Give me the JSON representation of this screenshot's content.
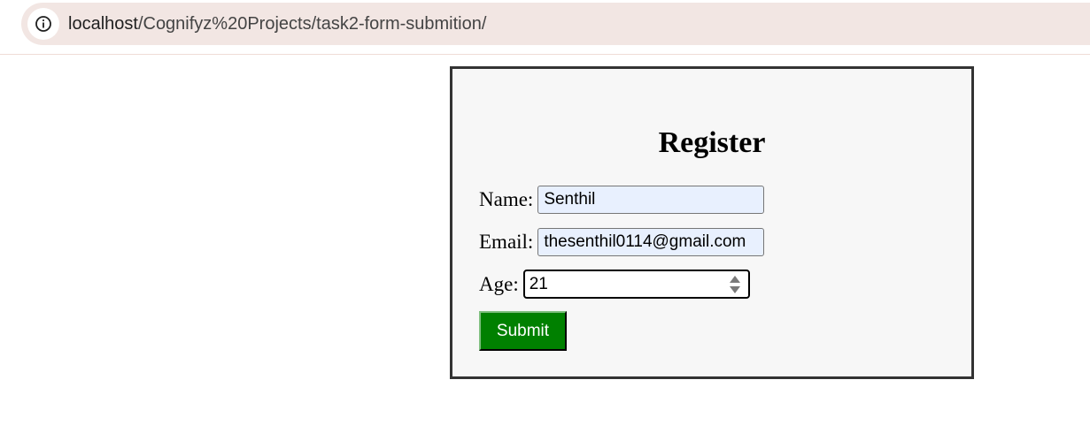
{
  "browser": {
    "url_host": "localhost",
    "url_path": "/Cognifyz%20Projects/task2-form-submition/",
    "site_info_icon": "info-icon"
  },
  "form": {
    "title": "Register",
    "name_label": "Name:",
    "name_value": "Senthil",
    "email_label": "Email:",
    "email_value": "thesenthil0114@gmail.com",
    "age_label": "Age:",
    "age_value": "21",
    "submit_label": "Submit",
    "submit_color": "#008000",
    "spinner_icon": "spin-arrows-icon"
  }
}
